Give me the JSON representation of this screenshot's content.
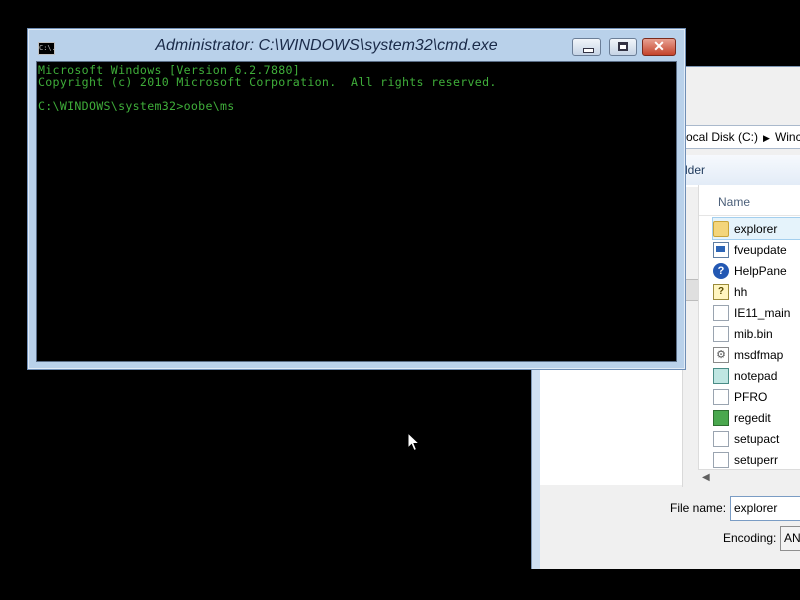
{
  "dialog": {
    "address": [
      "ocal Disk (C:)",
      "Winc"
    ],
    "toolbar_text": "lder",
    "column_name": "Name",
    "files": [
      {
        "name": "explorer",
        "icon": "folder-icon",
        "selected": true
      },
      {
        "name": "fveupdate",
        "icon": "app-icon"
      },
      {
        "name": "HelpPane",
        "icon": "help-icon"
      },
      {
        "name": "hh",
        "icon": "hh-icon"
      },
      {
        "name": "IE11_main",
        "icon": "document-icon"
      },
      {
        "name": "mib.bin",
        "icon": "document-icon"
      },
      {
        "name": "msdfmap",
        "icon": "gear-document-icon"
      },
      {
        "name": "notepad",
        "icon": "notepad-icon"
      },
      {
        "name": "PFRO",
        "icon": "document-icon"
      },
      {
        "name": "regedit",
        "icon": "regedit-icon"
      },
      {
        "name": "setupact",
        "icon": "document-icon"
      },
      {
        "name": "setuperr",
        "icon": "document-icon"
      }
    ],
    "file_name_label": "File name:",
    "file_name_value": "explorer",
    "encoding_label": "Encoding:",
    "encoding_value": "AN"
  },
  "cmd": {
    "title": "Administrator: C:\\WINDOWS\\system32\\cmd.exe",
    "icon_text": "C:\\.",
    "lines": [
      "Microsoft Windows [Version 6.2.7880]",
      "Copyright (c) 2010 Microsoft Corporation.  All rights reserved.",
      "",
      "C:\\WINDOWS\\system32>oobe\\ms"
    ],
    "text_color": "#3fae3a"
  }
}
